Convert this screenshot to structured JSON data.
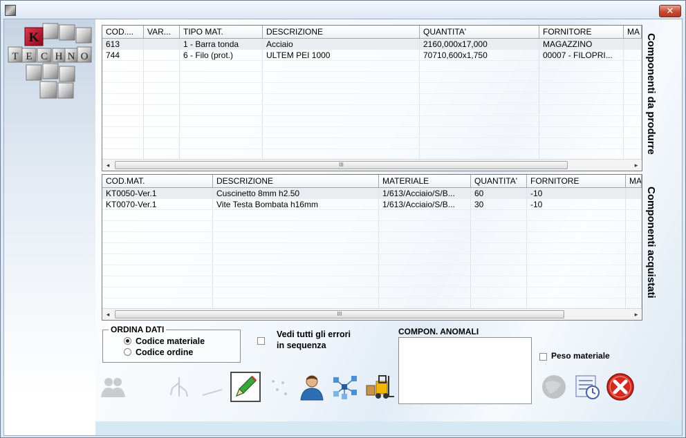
{
  "window": {
    "close_glyph": "✕"
  },
  "logo": {
    "letters": [
      "K",
      "T",
      "E",
      "C",
      "H",
      "N",
      "O"
    ],
    "accent": "#c8102e"
  },
  "grid_produrre": {
    "side_label": "Componenti da produrre",
    "columns": [
      "COD....",
      "VAR...",
      "TIPO MAT.",
      "DESCRIZIONE",
      "QUANTITA'",
      "FORNITORE",
      "MA"
    ],
    "rows": [
      [
        "613",
        "",
        "1 - Barra tonda",
        "Acciaio",
        "2160,000x17,000",
        "MAGAZZINO",
        ""
      ],
      [
        "744",
        "",
        "6 - Filo (prot.)",
        "ULTEM PEI 1000",
        "70710,600x1,750",
        "00007 - FILOPRI...",
        ""
      ]
    ],
    "scroll_grip": "III"
  },
  "grid_acquistati": {
    "side_label": "Componenti acquistati",
    "columns": [
      "COD.MAT.",
      "DESCRIZIONE",
      "MATERIALE",
      "QUANTITA'",
      "FORNITORE",
      "MA"
    ],
    "rows": [
      [
        "KT0050-Ver.1",
        "Cuscinetto 8mm h2.50",
        "1/613/Acciaio/S/B...",
        "60",
        "-10",
        ""
      ],
      [
        "KT0070-Ver.1",
        "Vite Testa Bombata h16mm",
        "1/613/Acciaio/S/B...",
        "30",
        "-10",
        ""
      ]
    ],
    "scroll_grip": "III"
  },
  "ordina": {
    "title": "ORDINA DATI",
    "options": [
      {
        "label": "Codice materiale",
        "selected": true
      },
      {
        "label": "Codice ordine",
        "selected": false
      }
    ]
  },
  "vedi_errori": {
    "line1": "Vedi tutti gli errori",
    "line2": "in sequenza",
    "checked": false
  },
  "anomali": {
    "title": "COMPON. ANOMALI"
  },
  "peso": {
    "label": "Peso materiale",
    "checked": false
  },
  "toolbar_icons": [
    "users-icon",
    "tree-icon",
    "line-icon",
    "edit-pencil-icon",
    "dots-icon",
    "user-icon",
    "network-icon",
    "forklift-icon",
    "globe-icon",
    "schedule-icon",
    "cancel-icon"
  ],
  "colors": {
    "accent_red": "#c8102e",
    "cancel_red": "#d42a1f",
    "bottom_strip": "#d6e8f4"
  }
}
